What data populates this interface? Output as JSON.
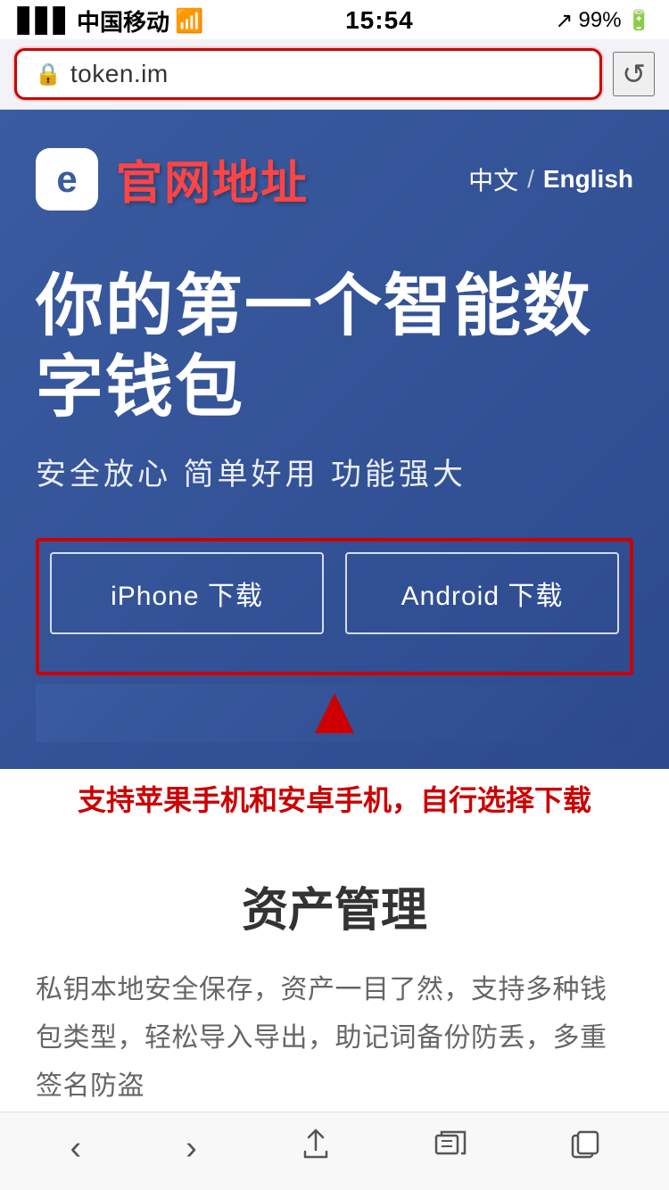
{
  "statusBar": {
    "carrier": "中国移动",
    "time": "15:54",
    "battery": "99%",
    "signal_icon": "📶",
    "wifi_icon": "📡",
    "location_icon": "↗"
  },
  "browserBar": {
    "url": "token.im",
    "lock_icon": "🔒",
    "refresh_icon": "↺"
  },
  "header": {
    "logo_letter": "e",
    "site_title": "官网地址",
    "lang_cn": "中文",
    "lang_divider": "/",
    "lang_en": "English"
  },
  "hero": {
    "title": "你的第一个智能数字钱包",
    "subtitle": "安全放心  简单好用  功能强大"
  },
  "buttons": {
    "iphone_download": "iPhone 下载",
    "android_download": "Android 下载"
  },
  "annotation": {
    "bottom_text": "支持苹果手机和安卓手机，自行选择下载"
  },
  "assetSection": {
    "title": "资产管理",
    "description": "私钥本地安全保存，资产一目了然，支持多种钱包类型，轻松导入导出，助记词备份防丢，多重签名防盗"
  },
  "bottomNav": {
    "back": "‹",
    "forward": "›",
    "share": "⬆",
    "bookmarks": "□□",
    "tabs": "⧉"
  }
}
